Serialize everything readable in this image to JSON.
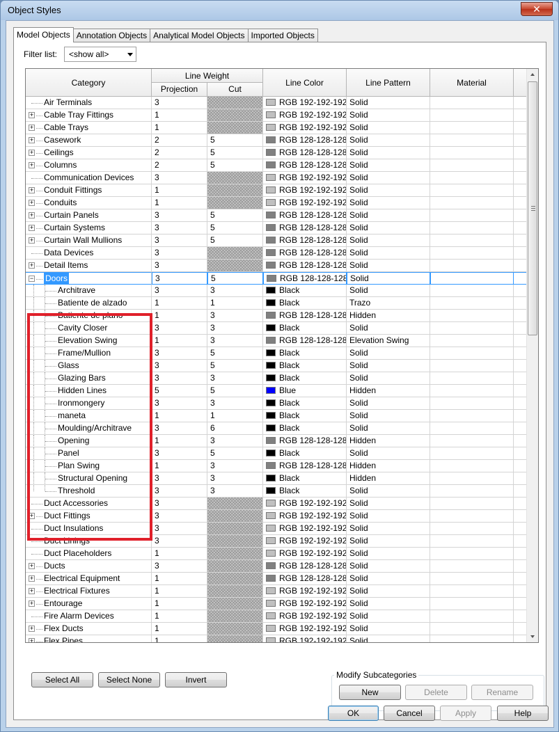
{
  "window": {
    "title": "Object Styles",
    "close_glyph": "✕"
  },
  "tabs": [
    {
      "label": "Model Objects",
      "active": true
    },
    {
      "label": "Annotation Objects",
      "active": false
    },
    {
      "label": "Analytical Model Objects",
      "active": false
    },
    {
      "label": "Imported Objects",
      "active": false
    }
  ],
  "filter": {
    "label": "Filter list:",
    "value": "<show all>"
  },
  "columns": {
    "category": "Category",
    "line_weight": "Line Weight",
    "projection": "Projection",
    "cut": "Cut",
    "line_color": "Line Color",
    "line_pattern": "Line Pattern",
    "material": "Material"
  },
  "colors": {
    "RGB 192-192-192": "#c0c0c0",
    "RGB 128-128-128": "#808080",
    "Black": "#000000",
    "Blue": "#0000ff",
    "selection": "#3399ff",
    "highlight_box": "#e0202a"
  },
  "rows": [
    {
      "name": "Air Terminals",
      "level": 0,
      "expander": false,
      "proj": "3",
      "cut": "",
      "color": "RGB 192-192-192",
      "pattern": "Solid"
    },
    {
      "name": "Cable Tray Fittings",
      "level": 0,
      "expander": true,
      "proj": "1",
      "cut": "",
      "color": "RGB 192-192-192",
      "pattern": "Solid"
    },
    {
      "name": "Cable Trays",
      "level": 0,
      "expander": true,
      "proj": "1",
      "cut": "",
      "color": "RGB 192-192-192",
      "pattern": "Solid"
    },
    {
      "name": "Casework",
      "level": 0,
      "expander": true,
      "proj": "2",
      "cut": "5",
      "color": "RGB 128-128-128",
      "pattern": "Solid"
    },
    {
      "name": "Ceilings",
      "level": 0,
      "expander": true,
      "proj": "2",
      "cut": "5",
      "color": "RGB 128-128-128",
      "pattern": "Solid"
    },
    {
      "name": "Columns",
      "level": 0,
      "expander": true,
      "proj": "2",
      "cut": "5",
      "color": "RGB 128-128-128",
      "pattern": "Solid"
    },
    {
      "name": "Communication Devices",
      "level": 0,
      "expander": false,
      "proj": "3",
      "cut": "",
      "color": "RGB 192-192-192",
      "pattern": "Solid"
    },
    {
      "name": "Conduit Fittings",
      "level": 0,
      "expander": true,
      "proj": "1",
      "cut": "",
      "color": "RGB 192-192-192",
      "pattern": "Solid"
    },
    {
      "name": "Conduits",
      "level": 0,
      "expander": true,
      "proj": "1",
      "cut": "",
      "color": "RGB 192-192-192",
      "pattern": "Solid"
    },
    {
      "name": "Curtain Panels",
      "level": 0,
      "expander": true,
      "proj": "3",
      "cut": "5",
      "color": "RGB 128-128-128",
      "pattern": "Solid"
    },
    {
      "name": "Curtain Systems",
      "level": 0,
      "expander": true,
      "proj": "3",
      "cut": "5",
      "color": "RGB 128-128-128",
      "pattern": "Solid"
    },
    {
      "name": "Curtain Wall Mullions",
      "level": 0,
      "expander": true,
      "proj": "3",
      "cut": "5",
      "color": "RGB 128-128-128",
      "pattern": "Solid"
    },
    {
      "name": "Data Devices",
      "level": 0,
      "expander": false,
      "proj": "3",
      "cut": "",
      "color": "RGB 128-128-128",
      "pattern": "Solid"
    },
    {
      "name": "Detail Items",
      "level": 0,
      "expander": true,
      "proj": "3",
      "cut": "",
      "color": "RGB 128-128-128",
      "pattern": "Solid"
    },
    {
      "name": "Doors",
      "level": 0,
      "expander": true,
      "expanded": true,
      "selected": true,
      "proj": "3",
      "cut": "5",
      "color": "RGB 128-128-128",
      "pattern": "Solid"
    },
    {
      "name": "Architrave",
      "level": 1,
      "proj": "3",
      "cut": "3",
      "color": "Black",
      "pattern": "Solid"
    },
    {
      "name": "Batiente de alzado",
      "level": 1,
      "proj": "1",
      "cut": "1",
      "color": "Black",
      "pattern": "Trazo"
    },
    {
      "name": "Batiente de plano",
      "level": 1,
      "proj": "1",
      "cut": "3",
      "color": "RGB 128-128-128",
      "pattern": "Hidden"
    },
    {
      "name": "Cavity Closer",
      "level": 1,
      "proj": "3",
      "cut": "3",
      "color": "Black",
      "pattern": "Solid"
    },
    {
      "name": "Elevation Swing",
      "level": 1,
      "proj": "1",
      "cut": "3",
      "color": "RGB 128-128-128",
      "pattern": "Elevation Swing"
    },
    {
      "name": "Frame/Mullion",
      "level": 1,
      "proj": "3",
      "cut": "5",
      "color": "Black",
      "pattern": "Solid"
    },
    {
      "name": "Glass",
      "level": 1,
      "proj": "3",
      "cut": "5",
      "color": "Black",
      "pattern": "Solid"
    },
    {
      "name": "Glazing Bars",
      "level": 1,
      "proj": "3",
      "cut": "3",
      "color": "Black",
      "pattern": "Solid"
    },
    {
      "name": "Hidden Lines",
      "level": 1,
      "proj": "5",
      "cut": "5",
      "color": "Blue",
      "pattern": "Hidden"
    },
    {
      "name": "Ironmongery",
      "level": 1,
      "proj": "3",
      "cut": "3",
      "color": "Black",
      "pattern": "Solid"
    },
    {
      "name": "maneta",
      "level": 1,
      "proj": "1",
      "cut": "1",
      "color": "Black",
      "pattern": "Solid"
    },
    {
      "name": "Moulding/Architrave",
      "level": 1,
      "proj": "3",
      "cut": "6",
      "color": "Black",
      "pattern": "Solid"
    },
    {
      "name": "Opening",
      "level": 1,
      "proj": "1",
      "cut": "3",
      "color": "RGB 128-128-128",
      "pattern": "Hidden"
    },
    {
      "name": "Panel",
      "level": 1,
      "proj": "3",
      "cut": "5",
      "color": "Black",
      "pattern": "Solid"
    },
    {
      "name": "Plan Swing",
      "level": 1,
      "proj": "1",
      "cut": "3",
      "color": "RGB 128-128-128",
      "pattern": "Hidden"
    },
    {
      "name": "Structural Opening",
      "level": 1,
      "proj": "3",
      "cut": "3",
      "color": "Black",
      "pattern": "Hidden"
    },
    {
      "name": "Threshold",
      "level": 1,
      "last": true,
      "proj": "3",
      "cut": "3",
      "color": "Black",
      "pattern": "Solid"
    },
    {
      "name": "Duct Accessories",
      "level": 0,
      "expander": false,
      "proj": "3",
      "cut": "",
      "color": "RGB 192-192-192",
      "pattern": "Solid"
    },
    {
      "name": "Duct Fittings",
      "level": 0,
      "expander": true,
      "proj": "3",
      "cut": "",
      "color": "RGB 192-192-192",
      "pattern": "Solid"
    },
    {
      "name": "Duct Insulations",
      "level": 0,
      "expander": false,
      "proj": "3",
      "cut": "",
      "color": "RGB 192-192-192",
      "pattern": "Solid"
    },
    {
      "name": "Duct Linings",
      "level": 0,
      "expander": false,
      "proj": "3",
      "cut": "",
      "color": "RGB 192-192-192",
      "pattern": "Solid"
    },
    {
      "name": "Duct Placeholders",
      "level": 0,
      "expander": false,
      "proj": "1",
      "cut": "",
      "color": "RGB 192-192-192",
      "pattern": "Solid"
    },
    {
      "name": "Ducts",
      "level": 0,
      "expander": true,
      "proj": "3",
      "cut": "",
      "color": "RGB 128-128-128",
      "pattern": "Solid"
    },
    {
      "name": "Electrical Equipment",
      "level": 0,
      "expander": true,
      "proj": "1",
      "cut": "",
      "color": "RGB 128-128-128",
      "pattern": "Solid"
    },
    {
      "name": "Electrical Fixtures",
      "level": 0,
      "expander": true,
      "proj": "1",
      "cut": "",
      "color": "RGB 192-192-192",
      "pattern": "Solid"
    },
    {
      "name": "Entourage",
      "level": 0,
      "expander": true,
      "proj": "1",
      "cut": "",
      "color": "RGB 192-192-192",
      "pattern": "Solid"
    },
    {
      "name": "Fire Alarm Devices",
      "level": 0,
      "expander": false,
      "proj": "1",
      "cut": "",
      "color": "RGB 192-192-192",
      "pattern": "Solid"
    },
    {
      "name": "Flex Ducts",
      "level": 0,
      "expander": true,
      "proj": "1",
      "cut": "",
      "color": "RGB 192-192-192",
      "pattern": "Solid"
    },
    {
      "name": "Flex Pipes",
      "level": 0,
      "expander": true,
      "proj": "1",
      "cut": "",
      "color": "RGB 192-192-192",
      "pattern": "Solid"
    }
  ],
  "buttons": {
    "select_all": "Select All",
    "select_none": "Select None",
    "invert": "Invert",
    "modify_group": "Modify Subcategories",
    "new": "New",
    "delete": "Delete",
    "rename": "Rename",
    "ok": "OK",
    "cancel": "Cancel",
    "apply": "Apply",
    "help": "Help"
  }
}
